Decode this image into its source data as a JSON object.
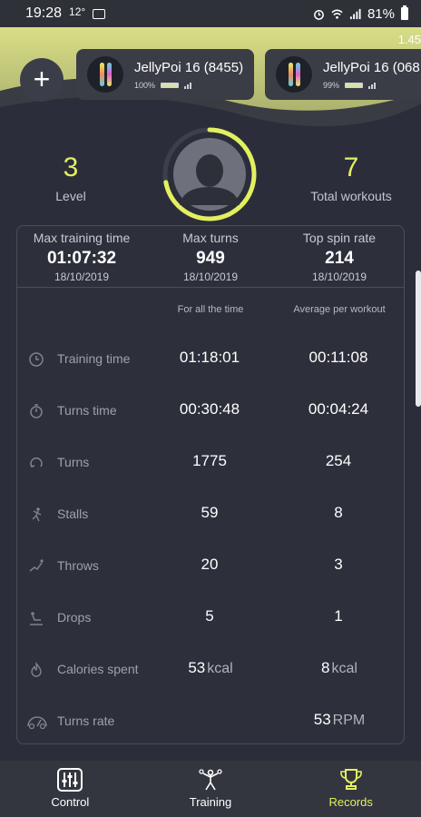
{
  "status_bar": {
    "time": "19:28",
    "temperature": "12°",
    "battery_percent": "81%"
  },
  "header": {
    "version": "1.45",
    "add_label": "+",
    "devices": [
      {
        "name": "JellyPoi 16 (8455)",
        "battery": "100%",
        "battery_level": 1.0
      },
      {
        "name": "JellyPoi 16 (068",
        "battery": "99%",
        "battery_level": 0.99
      }
    ]
  },
  "profile": {
    "level_value": "3",
    "level_label": "Level",
    "total_value": "7",
    "total_label": "Total workouts",
    "level_progress": 0.72
  },
  "records": [
    {
      "label": "Max training time",
      "value": "01:07:32",
      "date": "18/10/2019"
    },
    {
      "label": "Max turns",
      "value": "949",
      "date": "18/10/2019"
    },
    {
      "label": "Top spin rate",
      "value": "214",
      "date": "18/10/2019"
    }
  ],
  "columns": {
    "all_time": "For all the time",
    "average": "Average per workout"
  },
  "stats": [
    {
      "icon": "clock-icon",
      "label": "Training time",
      "all": "01:18:01",
      "all_unit": "",
      "avg": "00:11:08",
      "avg_unit": ""
    },
    {
      "icon": "timer-icon",
      "label": "Turns time",
      "all": "00:30:48",
      "all_unit": "",
      "avg": "00:04:24",
      "avg_unit": ""
    },
    {
      "icon": "turn-icon",
      "label": "Turns",
      "all": "1775",
      "all_unit": "",
      "avg": "254",
      "avg_unit": ""
    },
    {
      "icon": "stall-icon",
      "label": "Stalls",
      "all": "59",
      "all_unit": "",
      "avg": "8",
      "avg_unit": ""
    },
    {
      "icon": "throw-icon",
      "label": "Throws",
      "all": "20",
      "all_unit": "",
      "avg": "3",
      "avg_unit": ""
    },
    {
      "icon": "drop-icon",
      "label": "Drops",
      "all": "5",
      "all_unit": "",
      "avg": "1",
      "avg_unit": ""
    },
    {
      "icon": "flame-icon",
      "label": "Calories spent",
      "all": "53",
      "all_unit": "kcal",
      "avg": "8",
      "avg_unit": "kcal"
    },
    {
      "icon": "speedometer-icon",
      "label": "Turns rate",
      "all": "",
      "all_unit": "",
      "avg": "53",
      "avg_unit": "RPM"
    }
  ],
  "nav": {
    "control": "Control",
    "training": "Training",
    "records": "Records",
    "active": "records"
  },
  "colors": {
    "accent": "#e3ef5f",
    "background": "#2b2e3a"
  }
}
